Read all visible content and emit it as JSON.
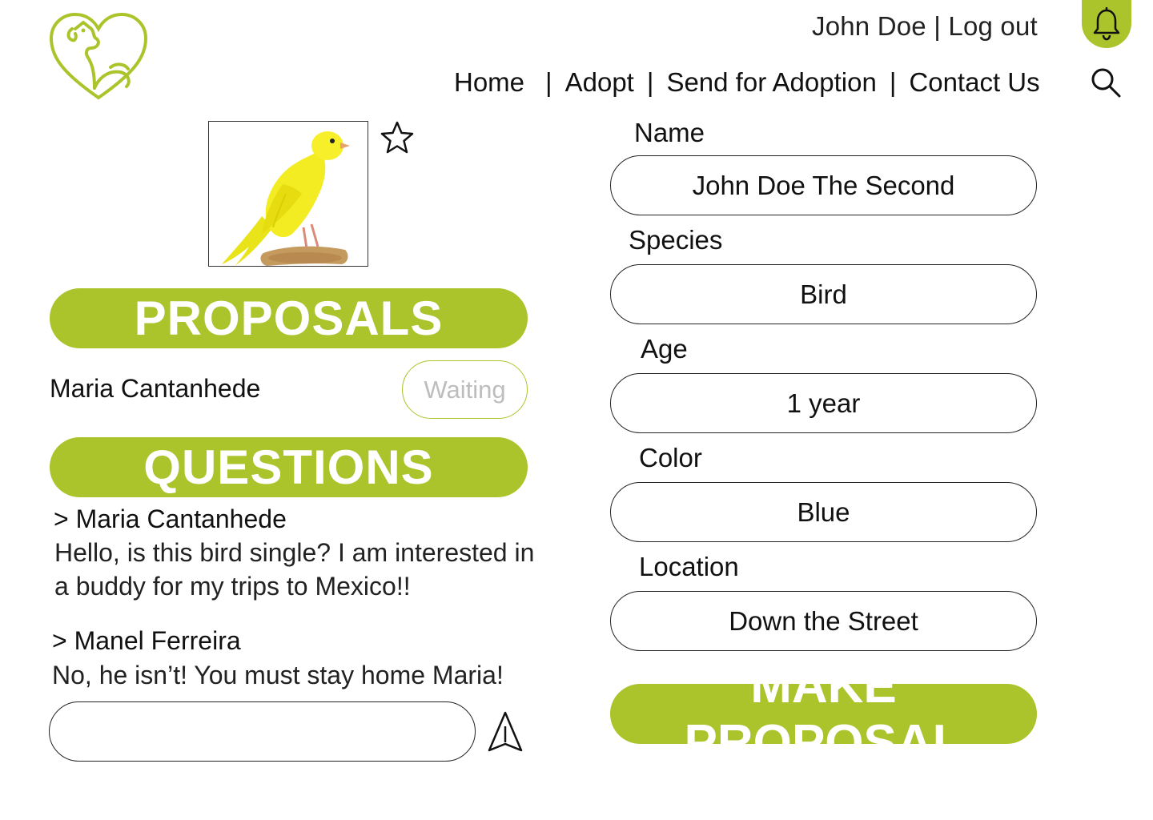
{
  "header": {
    "user_name": "John Doe",
    "separator": "|",
    "logout_label": "Log out",
    "logo_icon": "heart-dog-cat-logo",
    "notification_icon": "bell-icon",
    "search_icon": "search-icon"
  },
  "nav": {
    "items": [
      {
        "label": "Home"
      },
      {
        "label": "Adopt"
      },
      {
        "label": "Send for Adoption"
      },
      {
        "label": "Contact Us"
      }
    ],
    "separator": "|"
  },
  "pet": {
    "photo_icon": "canary-photo",
    "favorite_icon": "star-outline-icon",
    "fields": [
      {
        "label": "Name",
        "value": "John Doe The Second"
      },
      {
        "label": "Species",
        "value": "Bird"
      },
      {
        "label": "Age",
        "value": "1 year"
      },
      {
        "label": "Color",
        "value": "Blue"
      },
      {
        "label": "Location",
        "value": "Down the Street"
      }
    ]
  },
  "proposals": {
    "title": "PROPOSALS",
    "items": [
      {
        "name": "Maria Cantanhede",
        "status": "Waiting"
      }
    ]
  },
  "questions": {
    "title": "QUESTIONS",
    "items": [
      {
        "author": "> Maria Cantanhede",
        "text": "Hello, is this bird single? I am interested in a buddy for my trips to Mexico!!"
      },
      {
        "author": "> Manel Ferreira",
        "text": "No, he isn’t! You must stay home Maria!"
      }
    ],
    "input_value": "",
    "send_icon": "send-arrow-icon"
  },
  "actions": {
    "make_proposal_label": "MAKE PROPOSAL"
  },
  "colors": {
    "accent": "#abc42b",
    "status_text": "#bdbdbd"
  }
}
